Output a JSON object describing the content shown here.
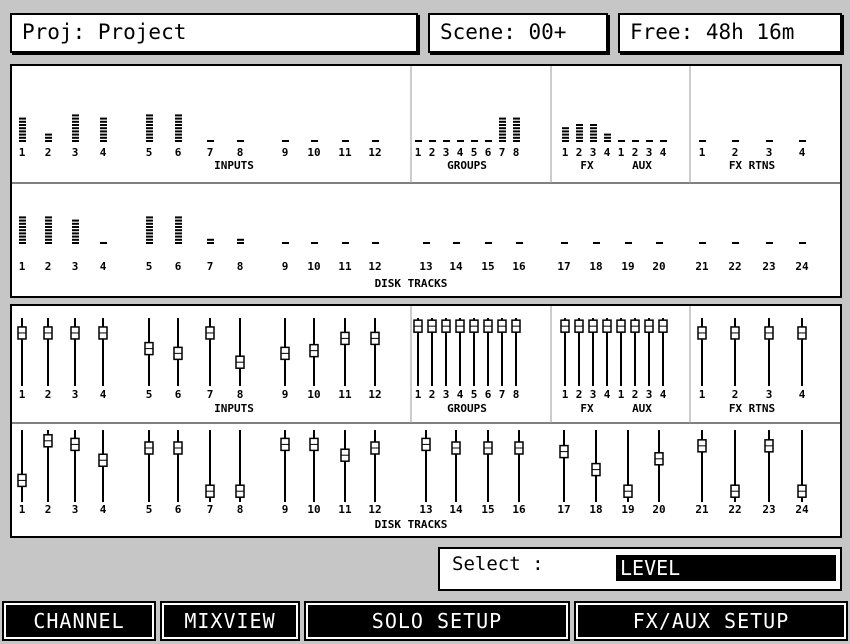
{
  "header": {
    "project": "Proj: Project",
    "scene": "Scene: 00+",
    "free": "Free: 48h 16m"
  },
  "meters": {
    "row1": {
      "inputs": {
        "title": "INPUTS",
        "labels": [
          "1",
          "2",
          "3",
          "4",
          "5",
          "6",
          "7",
          "8",
          "9",
          "10",
          "11",
          "12"
        ],
        "levels": [
          8,
          3,
          9,
          8,
          9,
          9,
          1,
          1,
          1,
          1,
          1,
          1
        ]
      },
      "groups": {
        "title": "GROUPS",
        "labels": [
          "1",
          "2",
          "3",
          "4",
          "5",
          "6",
          "7",
          "8"
        ],
        "levels": [
          1,
          1,
          1,
          1,
          1,
          1,
          8,
          8
        ]
      },
      "fx": {
        "title": "FX",
        "labels": [
          "1",
          "2",
          "3",
          "4"
        ],
        "levels": [
          5,
          6,
          6,
          3
        ]
      },
      "aux": {
        "title": "AUX",
        "labels": [
          "1",
          "2",
          "3",
          "4"
        ],
        "levels": [
          1,
          1,
          1,
          1
        ]
      },
      "fx_rtns": {
        "title": "FX RTNS",
        "labels": [
          "1",
          "2",
          "3",
          "4"
        ],
        "levels": [
          1,
          1,
          1,
          1
        ]
      }
    },
    "row2": {
      "title": "DISK TRACKS",
      "labels": [
        "1",
        "2",
        "3",
        "4",
        "5",
        "6",
        "7",
        "8",
        "9",
        "10",
        "11",
        "12",
        "13",
        "14",
        "15",
        "16",
        "17",
        "18",
        "19",
        "20",
        "21",
        "22",
        "23",
        "24"
      ],
      "levels": [
        9,
        9,
        8,
        1,
        9,
        9,
        2,
        2,
        1,
        1,
        1,
        1,
        1,
        1,
        1,
        1,
        1,
        1,
        1,
        1,
        1,
        1,
        1,
        1
      ]
    }
  },
  "faders": {
    "row1": {
      "inputs": {
        "title": "INPUTS",
        "labels": [
          "1",
          "2",
          "3",
          "4",
          "5",
          "6",
          "7",
          "8",
          "9",
          "10",
          "11",
          "12"
        ],
        "positions": [
          0.78,
          0.78,
          0.78,
          0.78,
          0.55,
          0.48,
          0.78,
          0.35,
          0.48,
          0.52,
          0.7,
          0.7
        ]
      },
      "groups": {
        "title": "GROUPS",
        "labels": [
          "1",
          "2",
          "3",
          "4",
          "5",
          "6",
          "7",
          "8"
        ],
        "positions": [
          0.88,
          0.88,
          0.88,
          0.88,
          0.88,
          0.88,
          0.88,
          0.88
        ]
      },
      "fx": {
        "title": "FX",
        "labels": [
          "1",
          "2",
          "3",
          "4"
        ],
        "positions": [
          0.88,
          0.88,
          0.88,
          0.88
        ]
      },
      "aux": {
        "title": "AUX",
        "labels": [
          "1",
          "2",
          "3",
          "4"
        ],
        "positions": [
          0.88,
          0.88,
          0.88,
          0.88
        ]
      },
      "fx_rtns": {
        "title": "FX RTNS",
        "labels": [
          "1",
          "2",
          "3",
          "4"
        ],
        "positions": [
          0.78,
          0.78,
          0.78,
          0.78
        ]
      }
    },
    "row2": {
      "title": "DISK TRACKS",
      "labels": [
        "1",
        "2",
        "3",
        "4",
        "5",
        "6",
        "7",
        "8",
        "9",
        "10",
        "11",
        "12",
        "13",
        "14",
        "15",
        "16",
        "17",
        "18",
        "19",
        "20",
        "21",
        "22",
        "23",
        "24"
      ],
      "positions": [
        0.3,
        0.85,
        0.8,
        0.58,
        0.75,
        0.75,
        0.15,
        0.15,
        0.8,
        0.8,
        0.65,
        0.75,
        0.8,
        0.75,
        0.75,
        0.75,
        0.7,
        0.45,
        0.15,
        0.6,
        0.78,
        0.15,
        0.78,
        0.15
      ]
    }
  },
  "select": {
    "label": "Select :",
    "value": "LEVEL"
  },
  "softkeys": [
    "CHANNEL",
    "MIXVIEW",
    "SOLO SETUP",
    "FX/AUX SETUP"
  ]
}
